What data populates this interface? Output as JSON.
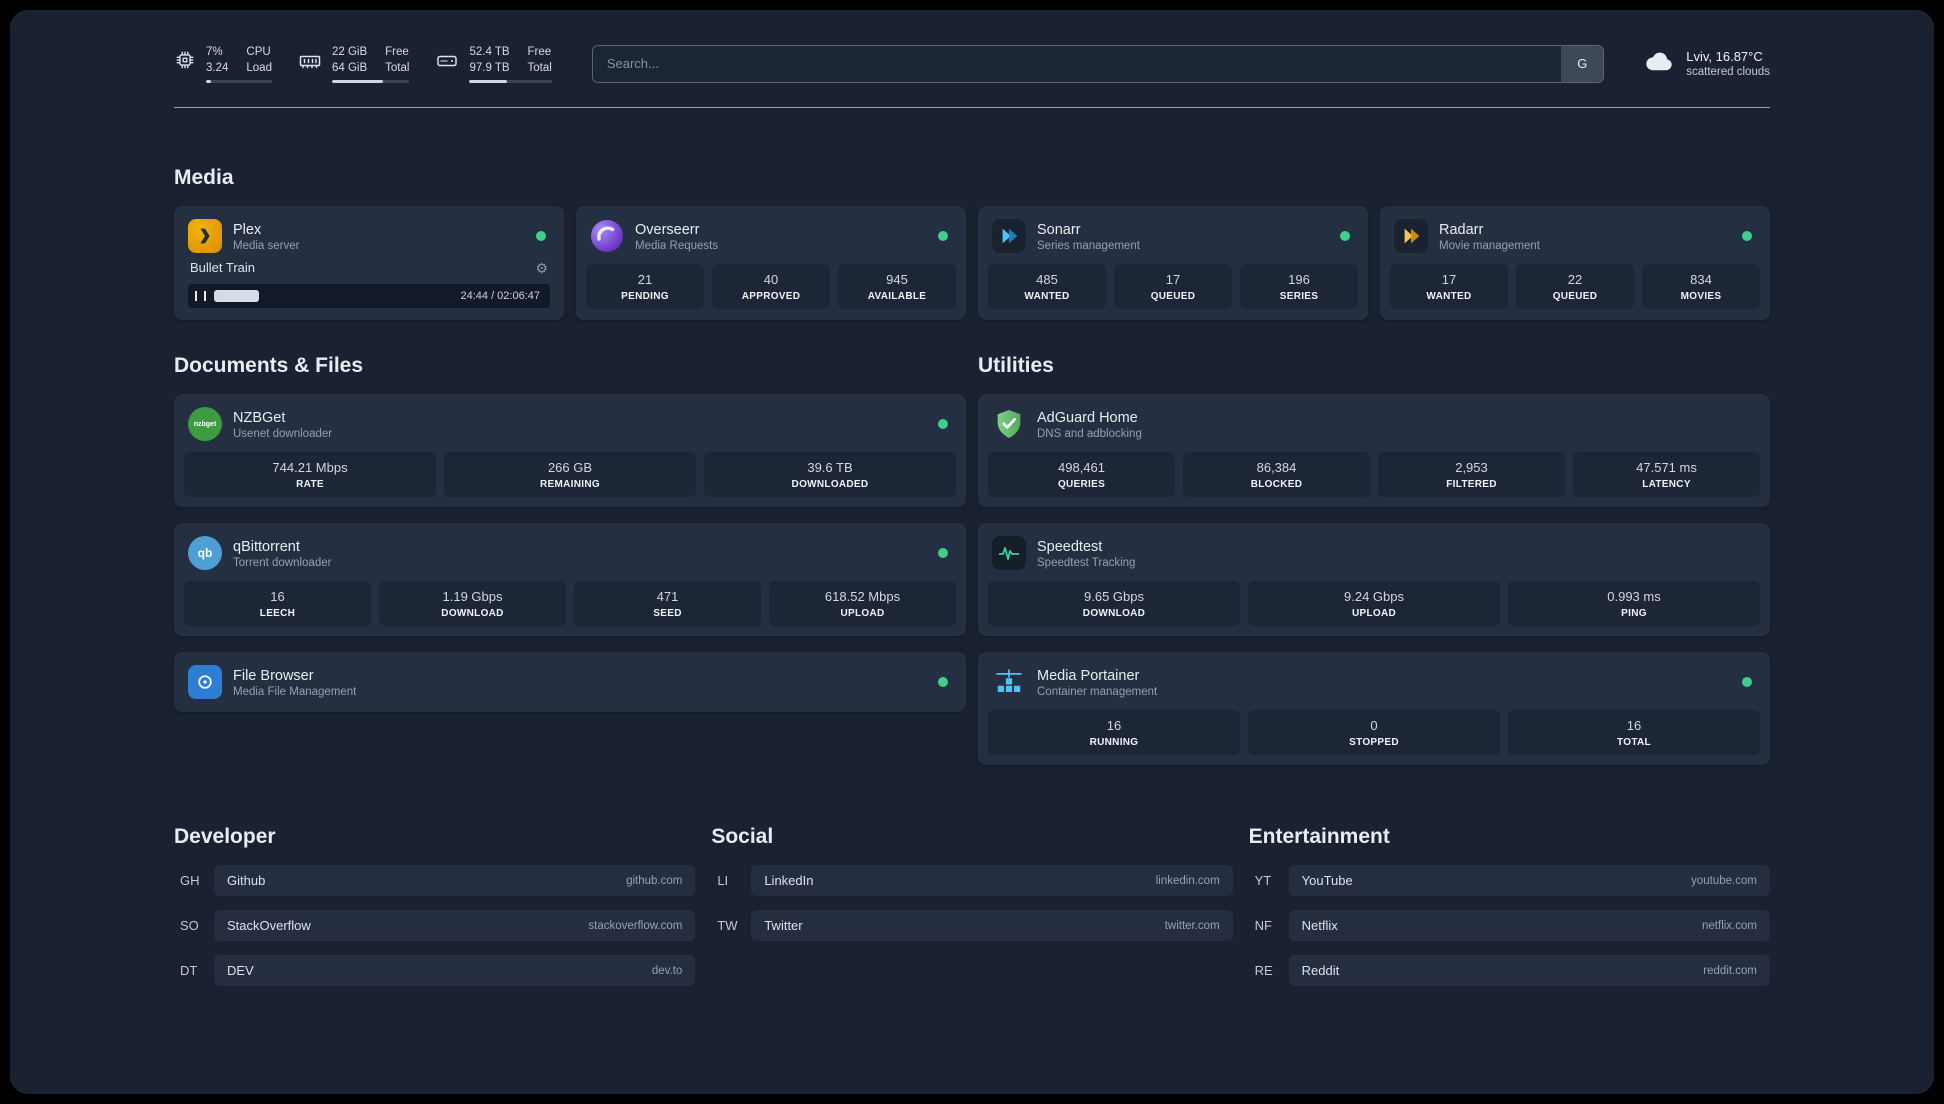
{
  "topbar": {
    "cpu": {
      "icon": "cpu-icon",
      "value_top": "7%",
      "value_bottom": "3.24",
      "label_top": "CPU",
      "label_bottom": "Load",
      "progress_pct": 7
    },
    "memory": {
      "icon": "memory-icon",
      "value_top": "22 GiB",
      "value_bottom": "64 GiB",
      "label_top": "Free",
      "label_bottom": "Total",
      "progress_pct": 66
    },
    "disk": {
      "icon": "disk-icon",
      "value_top": "52.4 TB",
      "value_bottom": "97.9 TB",
      "label_top": "Free",
      "label_bottom": "Total",
      "progress_pct": 46
    },
    "search": {
      "placeholder": "Search...",
      "provider_label": "G"
    },
    "weather": {
      "icon": "cloud-icon",
      "location": "Lviv, 16.87°C",
      "condition": "scattered clouds"
    }
  },
  "media": {
    "title": "Media",
    "services": [
      {
        "name": "Plex",
        "subtitle": "Media server",
        "icon": "plex-icon",
        "status": "online",
        "player": {
          "title": "Bullet Train",
          "time": "24:44 / 02:06:47",
          "progress_pct": 19
        }
      },
      {
        "name": "Overseerr",
        "subtitle": "Media Requests",
        "icon": "overseerr-icon",
        "status": "online",
        "stats": [
          {
            "value": "21",
            "label": "PENDING"
          },
          {
            "value": "40",
            "label": "APPROVED"
          },
          {
            "value": "945",
            "label": "AVAILABLE"
          }
        ]
      },
      {
        "name": "Sonarr",
        "subtitle": "Series management",
        "icon": "sonarr-icon",
        "status": "online",
        "stats": [
          {
            "value": "485",
            "label": "WANTED"
          },
          {
            "value": "17",
            "label": "QUEUED"
          },
          {
            "value": "196",
            "label": "SERIES"
          }
        ]
      },
      {
        "name": "Radarr",
        "subtitle": "Movie management",
        "icon": "radarr-icon",
        "status": "online",
        "stats": [
          {
            "value": "17",
            "label": "WANTED"
          },
          {
            "value": "22",
            "label": "QUEUED"
          },
          {
            "value": "834",
            "label": "MOVIES"
          }
        ]
      }
    ]
  },
  "documents": {
    "title": "Documents & Files",
    "services": [
      {
        "name": "NZBGet",
        "subtitle": "Usenet downloader",
        "icon": "nzbget-icon",
        "status": "online",
        "stats": [
          {
            "value": "744.21 Mbps",
            "label": "RATE"
          },
          {
            "value": "266 GB",
            "label": "REMAINING"
          },
          {
            "value": "39.6 TB",
            "label": "DOWNLOADED"
          }
        ]
      },
      {
        "name": "qBittorrent",
        "subtitle": "Torrent downloader",
        "icon": "qbittorrent-icon",
        "status": "online",
        "stats": [
          {
            "value": "16",
            "label": "LEECH"
          },
          {
            "value": "1.19 Gbps",
            "label": "DOWNLOAD"
          },
          {
            "value": "471",
            "label": "SEED"
          },
          {
            "value": "618.52 Mbps",
            "label": "UPLOAD"
          }
        ]
      },
      {
        "name": "File Browser",
        "subtitle": "Media File Management",
        "icon": "filebrowser-icon",
        "status": "online",
        "stats": []
      }
    ]
  },
  "utilities": {
    "title": "Utilities",
    "services": [
      {
        "name": "AdGuard Home",
        "subtitle": "DNS and adblocking",
        "icon": "adguard-icon",
        "stats": [
          {
            "value": "498,461",
            "label": "QUERIES"
          },
          {
            "value": "86,384",
            "label": "BLOCKED"
          },
          {
            "value": "2,953",
            "label": "FILTERED"
          },
          {
            "value": "47.571 ms",
            "label": "LATENCY"
          }
        ]
      },
      {
        "name": "Speedtest",
        "subtitle": "Speedtest Tracking",
        "icon": "speedtest-icon",
        "stats": [
          {
            "value": "9.65 Gbps",
            "label": "DOWNLOAD"
          },
          {
            "value": "9.24 Gbps",
            "label": "UPLOAD"
          },
          {
            "value": "0.993 ms",
            "label": "PING"
          }
        ]
      },
      {
        "name": "Media Portainer",
        "subtitle": "Container management",
        "icon": "portainer-icon",
        "status": "online",
        "stats": [
          {
            "value": "16",
            "label": "RUNNING"
          },
          {
            "value": "0",
            "label": "STOPPED"
          },
          {
            "value": "16",
            "label": "TOTAL"
          }
        ]
      }
    ]
  },
  "bookmarks": [
    {
      "title": "Developer",
      "items": [
        {
          "abbr": "GH",
          "name": "Github",
          "domain": "github.com"
        },
        {
          "abbr": "SO",
          "name": "StackOverflow",
          "domain": "stackoverflow.com"
        },
        {
          "abbr": "DT",
          "name": "DEV",
          "domain": "dev.to"
        }
      ]
    },
    {
      "title": "Social",
      "items": [
        {
          "abbr": "LI",
          "name": "LinkedIn",
          "domain": "linkedin.com"
        },
        {
          "abbr": "TW",
          "name": "Twitter",
          "domain": "twitter.com"
        }
      ]
    },
    {
      "title": "Entertainment",
      "items": [
        {
          "abbr": "YT",
          "name": "YouTube",
          "domain": "youtube.com"
        },
        {
          "abbr": "NF",
          "name": "Netflix",
          "domain": "netflix.com"
        },
        {
          "abbr": "RE",
          "name": "Reddit",
          "domain": "reddit.com"
        }
      ]
    }
  ],
  "colors": {
    "status_online": "#3ecf8e",
    "plex_amber": "#e8a10e",
    "overseerr_purple": "#7c5cbf",
    "sonarr_blue": "#4fc3f7",
    "radarr_amber": "#ffc24b",
    "nzbget_green": "#3d9c40",
    "qbittorrent_blue": "#4e9fd4",
    "filebrowser_blue": "#2e7fd4",
    "adguard_green": "#5cab63",
    "speedtest_green": "#34d399",
    "portainer_blue": "#4fc3f7"
  }
}
